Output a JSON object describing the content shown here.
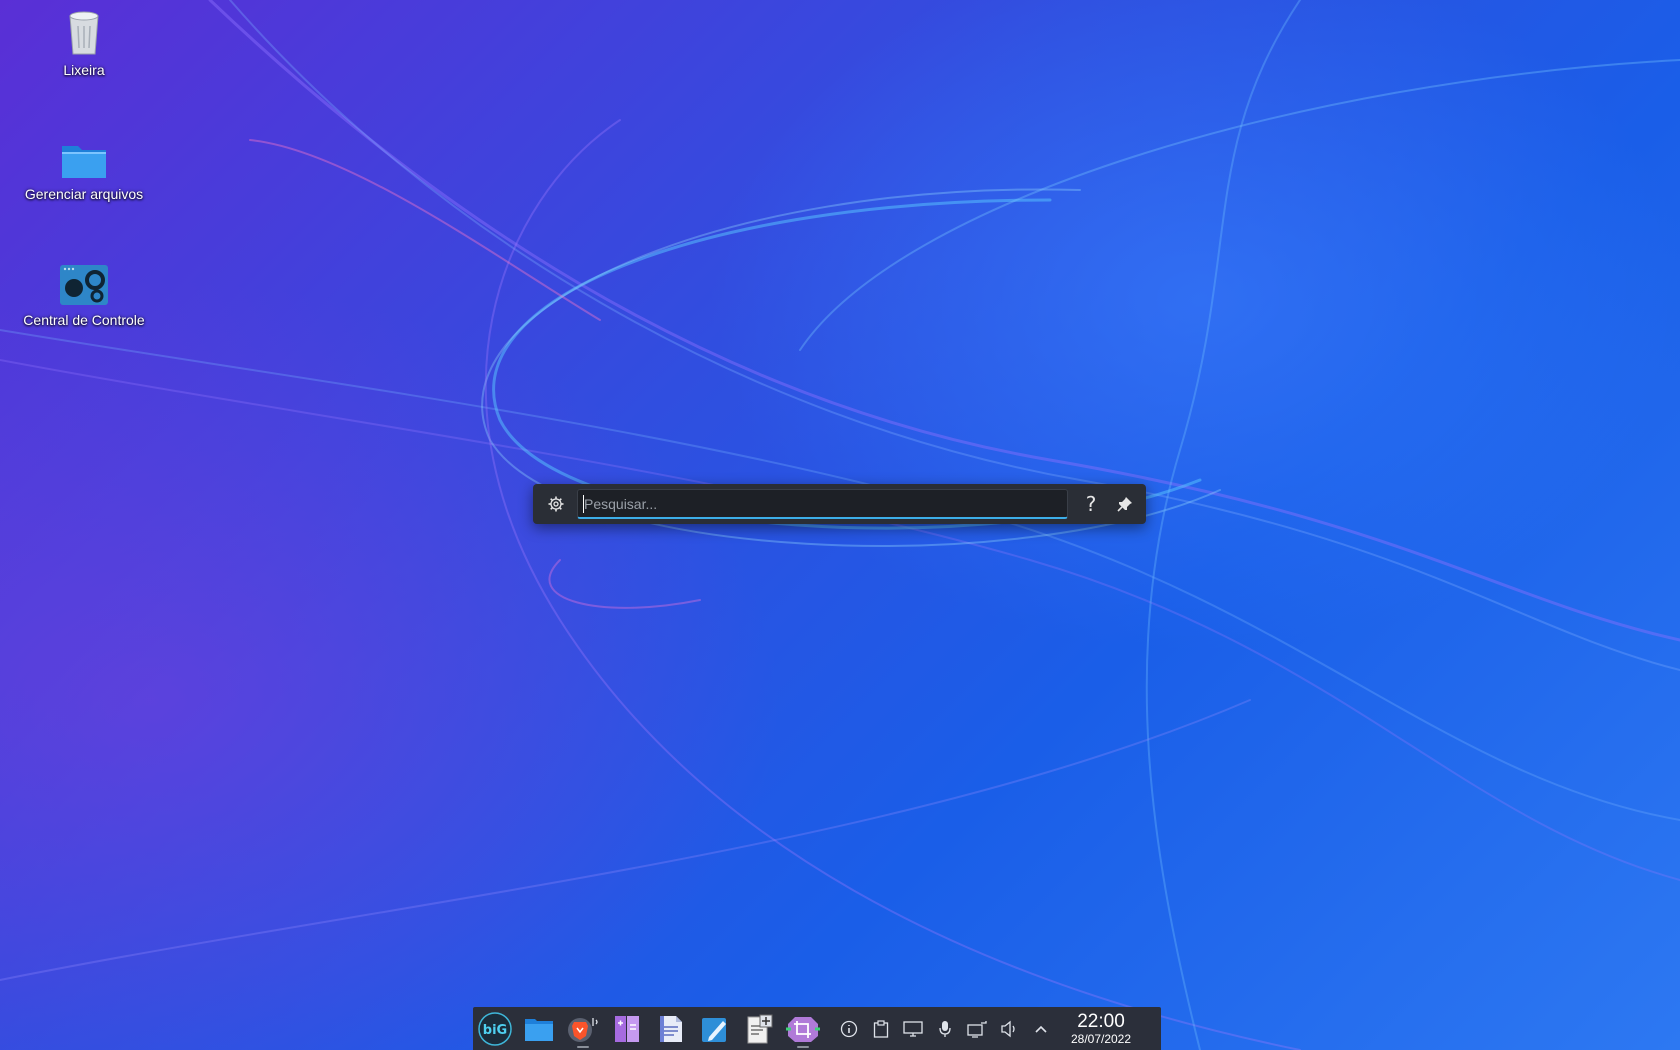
{
  "desktop": {
    "icons": [
      {
        "label": "Lixeira",
        "icon": "trash-icon"
      },
      {
        "label": "Gerenciar arquivos",
        "icon": "folder-icon"
      },
      {
        "label": "Central de Controle",
        "icon": "control-center-icon"
      }
    ]
  },
  "krunner": {
    "placeholder": "Pesquisar...",
    "value": "",
    "help_label": "?",
    "icons": {
      "settings": "gear-icon",
      "help": "help-icon",
      "pin": "pin-icon"
    }
  },
  "taskbar": {
    "apps": [
      {
        "name": "biglinux-menu-icon",
        "active": false
      },
      {
        "name": "file-manager-icon",
        "active": false
      },
      {
        "name": "brave-browser-icon",
        "active": true
      },
      {
        "name": "kate-sidebar-icon",
        "active": false
      },
      {
        "name": "document-viewer-icon",
        "active": false
      },
      {
        "name": "text-editor-icon",
        "active": false
      },
      {
        "name": "clipboard-editor-icon",
        "active": false
      },
      {
        "name": "screenshot-crop-icon",
        "active": true
      }
    ],
    "tray": [
      "info-icon",
      "clipboard-icon",
      "display-icon",
      "microphone-icon",
      "network-icon",
      "volume-icon",
      "expand-tray-icon"
    ],
    "clock": {
      "time": "22:00",
      "date": "28/07/2022"
    }
  },
  "colors": {
    "accent": "#3daee9",
    "panel": "#2b2f3a",
    "krunner_bg": "#2a2e36"
  }
}
